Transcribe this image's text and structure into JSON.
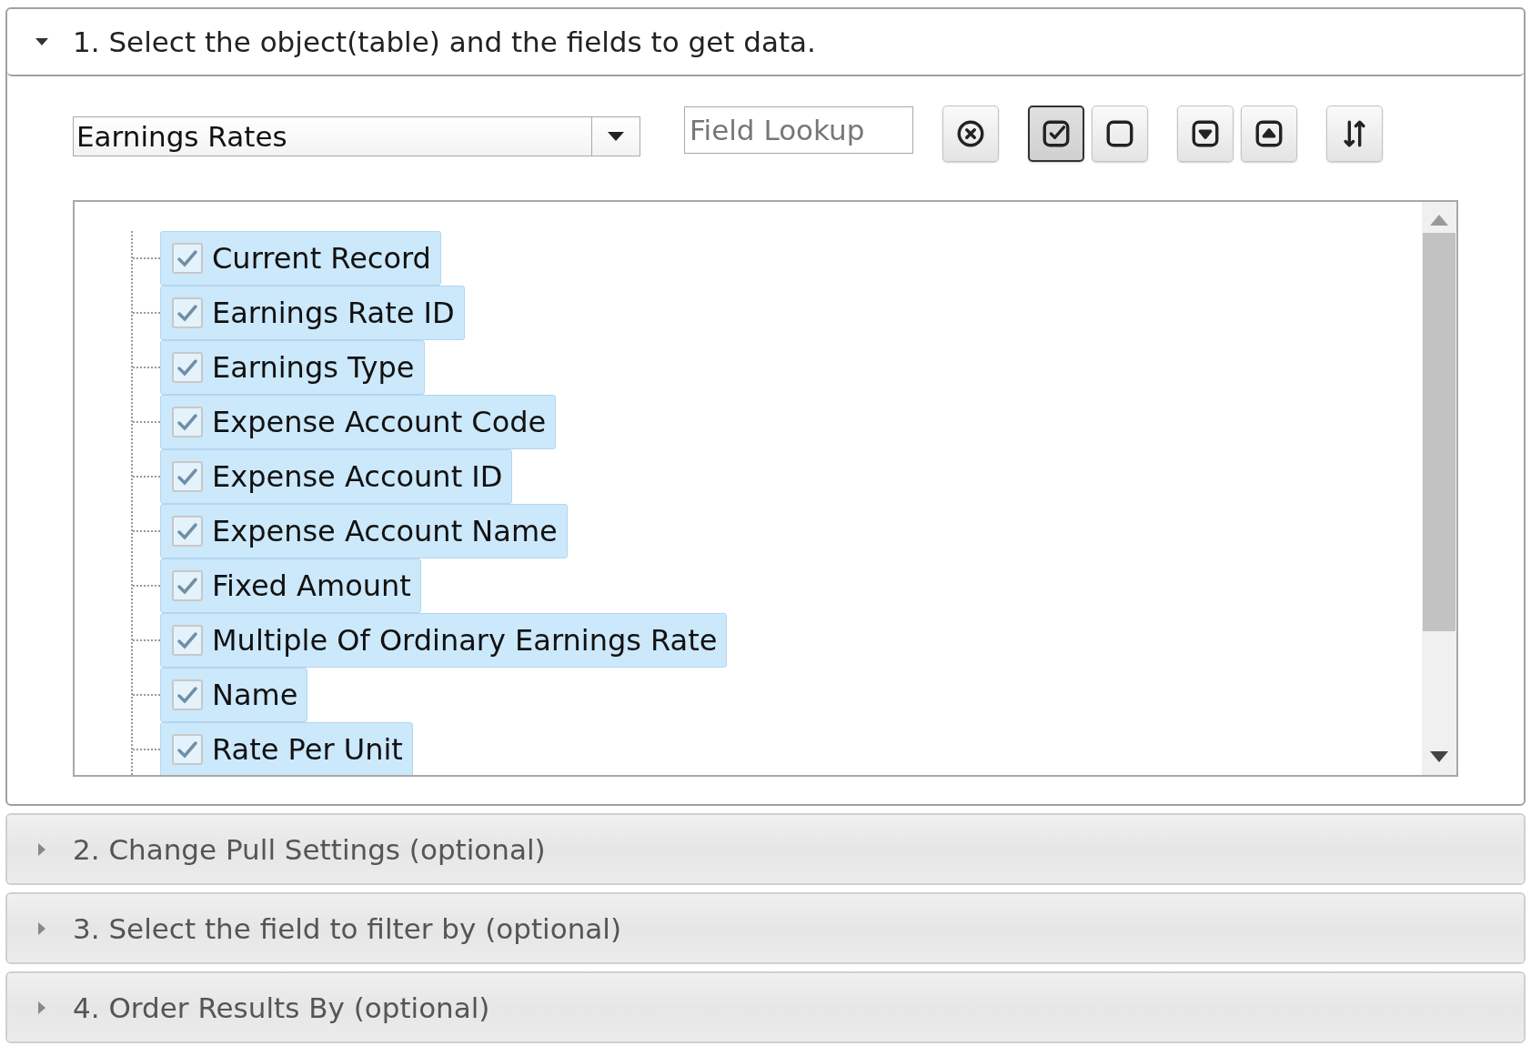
{
  "panels": [
    {
      "title": "1. Select the object(table) and the fields to get data.",
      "expanded": true,
      "object_select": {
        "value": "Earnings Rates"
      },
      "field_lookup": {
        "placeholder": "Field Lookup"
      },
      "toolbar": [
        {
          "kind": "clear",
          "selected": false
        },
        {
          "kind": "check-all",
          "selected": true
        },
        {
          "kind": "uncheck-all",
          "selected": false
        },
        {
          "kind": "expand",
          "selected": false
        },
        {
          "kind": "collapse",
          "selected": false
        },
        {
          "kind": "sort",
          "selected": false
        }
      ],
      "fields": [
        {
          "label": "Current Record",
          "checked": true
        },
        {
          "label": "Earnings Rate ID",
          "checked": true
        },
        {
          "label": "Earnings Type",
          "checked": true
        },
        {
          "label": "Expense Account Code",
          "checked": true
        },
        {
          "label": "Expense Account ID",
          "checked": true
        },
        {
          "label": "Expense Account Name",
          "checked": true
        },
        {
          "label": "Fixed Amount",
          "checked": true
        },
        {
          "label": "Multiple Of Ordinary Earnings Rate",
          "checked": true
        },
        {
          "label": "Name",
          "checked": true
        },
        {
          "label": "Rate Per Unit",
          "checked": true
        }
      ]
    },
    {
      "title": "2. Change Pull Settings (optional)",
      "expanded": false
    },
    {
      "title": "3. Select the field to filter by (optional)",
      "expanded": false
    },
    {
      "title": "4. Order Results By (optional)",
      "expanded": false
    }
  ]
}
